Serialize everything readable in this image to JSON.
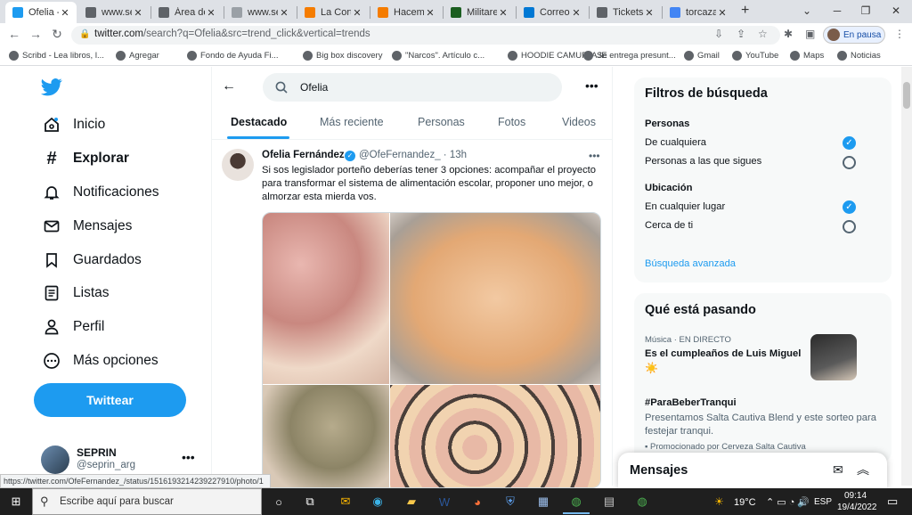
{
  "browser": {
    "tabs": [
      {
        "title": "Ofelia - ",
        "icon": "twitter-icon",
        "color": "#1d9bf0",
        "active": true
      },
      {
        "title": "www.sep",
        "icon": "globe-icon",
        "color": "#5f6368"
      },
      {
        "title": "Área de",
        "icon": "globe-icon",
        "color": "#5f6368"
      },
      {
        "title": "www.se",
        "icon": "document-icon",
        "color": "#9aa0a6"
      },
      {
        "title": "La Corte",
        "icon": "blogger-icon",
        "color": "#f57c00"
      },
      {
        "title": "Hacemo",
        "icon": "blogger-icon",
        "color": "#f57c00"
      },
      {
        "title": "Militare",
        "icon": "news-icon",
        "color": "#1b5e20"
      },
      {
        "title": "Correo",
        "icon": "outlook-icon",
        "color": "#0078d4"
      },
      {
        "title": "Tickets",
        "icon": "globe-icon",
        "color": "#5f6368"
      },
      {
        "title": "torcaza",
        "icon": "google-icon",
        "color": "#4285f4"
      }
    ],
    "new_tab_glyph": "+",
    "url_host": "twitter.com",
    "url_path": "/search?q=Ofelia&src=trend_click&vertical=trends",
    "profile_label": "En pausa",
    "bookmarks": [
      {
        "label": "Scribd - Lea libros, l..."
      },
      {
        "label": "Agregar"
      },
      {
        "label": "Fondo de Ayuda Fi..."
      },
      {
        "label": "Big box discovery"
      },
      {
        "label": "\"Narcos\". Artículo c..."
      },
      {
        "label": "HOODIE CAMUFLAJE"
      },
      {
        "label": "Se entrega presunt..."
      },
      {
        "label": "Gmail"
      },
      {
        "label": "YouTube"
      },
      {
        "label": "Maps"
      },
      {
        "label": "Noticias"
      }
    ],
    "status_url": "https://twitter.com/OfeFernandez_/status/1516193214239227910/photo/1"
  },
  "twitter": {
    "nav": [
      {
        "label": "Inicio",
        "icon": "home-icon"
      },
      {
        "label": "Explorar",
        "icon": "hashtag-icon"
      },
      {
        "label": "Notificaciones",
        "icon": "bell-icon"
      },
      {
        "label": "Mensajes",
        "icon": "mail-icon"
      },
      {
        "label": "Guardados",
        "icon": "bookmark-icon"
      },
      {
        "label": "Listas",
        "icon": "list-icon"
      },
      {
        "label": "Perfil",
        "icon": "person-icon"
      },
      {
        "label": "Más opciones",
        "icon": "more-circle-icon"
      }
    ],
    "tweet_button": "Twittear",
    "account": {
      "name": "SEPRIN",
      "handle": "@seprin_arg"
    },
    "search_value": "Ofelia",
    "search_tabs": [
      "Destacado",
      "Más reciente",
      "Personas",
      "Fotos",
      "Videos"
    ],
    "tweet": {
      "author": "Ofelia Fernández",
      "handle": "@OfeFernandez_",
      "time": "· 13h",
      "text": "Si sos legislador porteño deberías tener 3 opciones: acompañar el proyecto para transformar el sistema de alimentación escolar, proponer uno mejor, o almorzar esta mierda vos."
    },
    "filters": {
      "title": "Filtros de búsqueda",
      "people_heading": "Personas",
      "people_options": [
        "De cualquiera",
        "Personas a las que sigues"
      ],
      "location_heading": "Ubicación",
      "location_options": [
        "En cualquier lugar",
        "Cerca de ti"
      ],
      "advanced_link": "Búsqueda avanzada"
    },
    "trends": {
      "title": "Qué está pasando",
      "items": [
        {
          "meta": "Música · EN DIRECTO",
          "title": "Es el cumpleaños de Luis Miguel",
          "extra": "☀️"
        },
        {
          "title": "#ParaBeberTranqui",
          "desc": "Presentamos Salta Cautiva Blend y este sorteo para festejar tranqui.",
          "promo": "Promocionado por Cerveza Salta Cautiva"
        }
      ]
    },
    "messages_title": "Mensajes",
    "accent": "#1d9bf0"
  },
  "taskbar": {
    "search_placeholder": "Escribe aquí para buscar",
    "weather": "19°C",
    "lang": "ESP",
    "time": "09:14",
    "date": "19/4/2022"
  }
}
